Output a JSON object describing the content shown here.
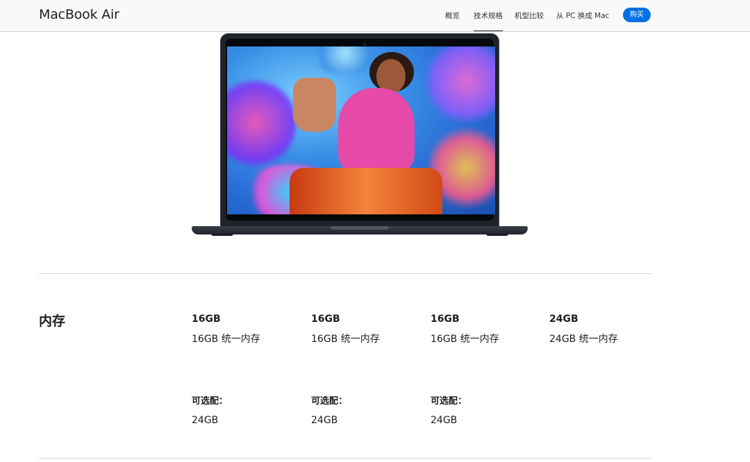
{
  "nav": {
    "brand": "MacBook Air",
    "links": [
      {
        "label": "概览",
        "active": false
      },
      {
        "label": "技术规格",
        "active": true
      },
      {
        "label": "机型比较",
        "active": false
      },
      {
        "label": "从 PC 换成 Mac",
        "active": false
      }
    ],
    "buy_label": "购买"
  },
  "memory": {
    "title": "内存",
    "configs": [
      {
        "capacity": "16GB",
        "description": "16GB 统一内存",
        "option_label": "可选配：",
        "option_value": "24GB"
      },
      {
        "capacity": "16GB",
        "description": "16GB 统一内存",
        "option_label": "可选配：",
        "option_value": "24GB"
      },
      {
        "capacity": "16GB",
        "description": "16GB 统一内存",
        "option_label": "可选配：",
        "option_value": "24GB"
      },
      {
        "capacity": "24GB",
        "description": "24GB 统一内存"
      }
    ]
  },
  "colors": {
    "accent": "#0071e3",
    "laptop": "#1f232b"
  },
  "icons": [
    "macbook-air-product-image"
  ]
}
